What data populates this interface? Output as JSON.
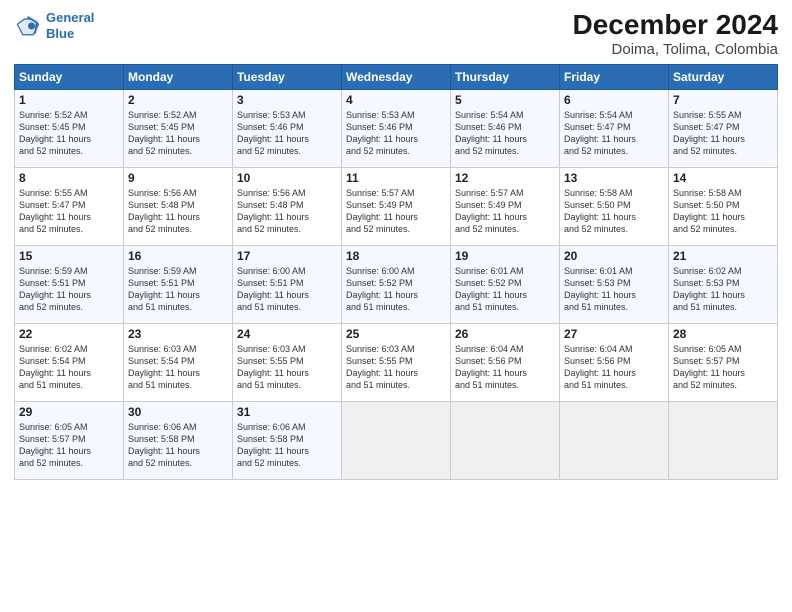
{
  "header": {
    "logo_line1": "General",
    "logo_line2": "Blue",
    "title": "December 2024",
    "subtitle": "Doima, Tolima, Colombia"
  },
  "days_of_week": [
    "Sunday",
    "Monday",
    "Tuesday",
    "Wednesday",
    "Thursday",
    "Friday",
    "Saturday"
  ],
  "weeks": [
    [
      {
        "day": "1",
        "info": "Sunrise: 5:52 AM\nSunset: 5:45 PM\nDaylight: 11 hours\nand 52 minutes."
      },
      {
        "day": "2",
        "info": "Sunrise: 5:52 AM\nSunset: 5:45 PM\nDaylight: 11 hours\nand 52 minutes."
      },
      {
        "day": "3",
        "info": "Sunrise: 5:53 AM\nSunset: 5:46 PM\nDaylight: 11 hours\nand 52 minutes."
      },
      {
        "day": "4",
        "info": "Sunrise: 5:53 AM\nSunset: 5:46 PM\nDaylight: 11 hours\nand 52 minutes."
      },
      {
        "day": "5",
        "info": "Sunrise: 5:54 AM\nSunset: 5:46 PM\nDaylight: 11 hours\nand 52 minutes."
      },
      {
        "day": "6",
        "info": "Sunrise: 5:54 AM\nSunset: 5:47 PM\nDaylight: 11 hours\nand 52 minutes."
      },
      {
        "day": "7",
        "info": "Sunrise: 5:55 AM\nSunset: 5:47 PM\nDaylight: 11 hours\nand 52 minutes."
      }
    ],
    [
      {
        "day": "8",
        "info": "Sunrise: 5:55 AM\nSunset: 5:47 PM\nDaylight: 11 hours\nand 52 minutes."
      },
      {
        "day": "9",
        "info": "Sunrise: 5:56 AM\nSunset: 5:48 PM\nDaylight: 11 hours\nand 52 minutes."
      },
      {
        "day": "10",
        "info": "Sunrise: 5:56 AM\nSunset: 5:48 PM\nDaylight: 11 hours\nand 52 minutes."
      },
      {
        "day": "11",
        "info": "Sunrise: 5:57 AM\nSunset: 5:49 PM\nDaylight: 11 hours\nand 52 minutes."
      },
      {
        "day": "12",
        "info": "Sunrise: 5:57 AM\nSunset: 5:49 PM\nDaylight: 11 hours\nand 52 minutes."
      },
      {
        "day": "13",
        "info": "Sunrise: 5:58 AM\nSunset: 5:50 PM\nDaylight: 11 hours\nand 52 minutes."
      },
      {
        "day": "14",
        "info": "Sunrise: 5:58 AM\nSunset: 5:50 PM\nDaylight: 11 hours\nand 52 minutes."
      }
    ],
    [
      {
        "day": "15",
        "info": "Sunrise: 5:59 AM\nSunset: 5:51 PM\nDaylight: 11 hours\nand 52 minutes."
      },
      {
        "day": "16",
        "info": "Sunrise: 5:59 AM\nSunset: 5:51 PM\nDaylight: 11 hours\nand 51 minutes."
      },
      {
        "day": "17",
        "info": "Sunrise: 6:00 AM\nSunset: 5:51 PM\nDaylight: 11 hours\nand 51 minutes."
      },
      {
        "day": "18",
        "info": "Sunrise: 6:00 AM\nSunset: 5:52 PM\nDaylight: 11 hours\nand 51 minutes."
      },
      {
        "day": "19",
        "info": "Sunrise: 6:01 AM\nSunset: 5:52 PM\nDaylight: 11 hours\nand 51 minutes."
      },
      {
        "day": "20",
        "info": "Sunrise: 6:01 AM\nSunset: 5:53 PM\nDaylight: 11 hours\nand 51 minutes."
      },
      {
        "day": "21",
        "info": "Sunrise: 6:02 AM\nSunset: 5:53 PM\nDaylight: 11 hours\nand 51 minutes."
      }
    ],
    [
      {
        "day": "22",
        "info": "Sunrise: 6:02 AM\nSunset: 5:54 PM\nDaylight: 11 hours\nand 51 minutes."
      },
      {
        "day": "23",
        "info": "Sunrise: 6:03 AM\nSunset: 5:54 PM\nDaylight: 11 hours\nand 51 minutes."
      },
      {
        "day": "24",
        "info": "Sunrise: 6:03 AM\nSunset: 5:55 PM\nDaylight: 11 hours\nand 51 minutes."
      },
      {
        "day": "25",
        "info": "Sunrise: 6:03 AM\nSunset: 5:55 PM\nDaylight: 11 hours\nand 51 minutes."
      },
      {
        "day": "26",
        "info": "Sunrise: 6:04 AM\nSunset: 5:56 PM\nDaylight: 11 hours\nand 51 minutes."
      },
      {
        "day": "27",
        "info": "Sunrise: 6:04 AM\nSunset: 5:56 PM\nDaylight: 11 hours\nand 51 minutes."
      },
      {
        "day": "28",
        "info": "Sunrise: 6:05 AM\nSunset: 5:57 PM\nDaylight: 11 hours\nand 52 minutes."
      }
    ],
    [
      {
        "day": "29",
        "info": "Sunrise: 6:05 AM\nSunset: 5:57 PM\nDaylight: 11 hours\nand 52 minutes."
      },
      {
        "day": "30",
        "info": "Sunrise: 6:06 AM\nSunset: 5:58 PM\nDaylight: 11 hours\nand 52 minutes."
      },
      {
        "day": "31",
        "info": "Sunrise: 6:06 AM\nSunset: 5:58 PM\nDaylight: 11 hours\nand 52 minutes."
      },
      {
        "day": "",
        "info": ""
      },
      {
        "day": "",
        "info": ""
      },
      {
        "day": "",
        "info": ""
      },
      {
        "day": "",
        "info": ""
      }
    ]
  ]
}
